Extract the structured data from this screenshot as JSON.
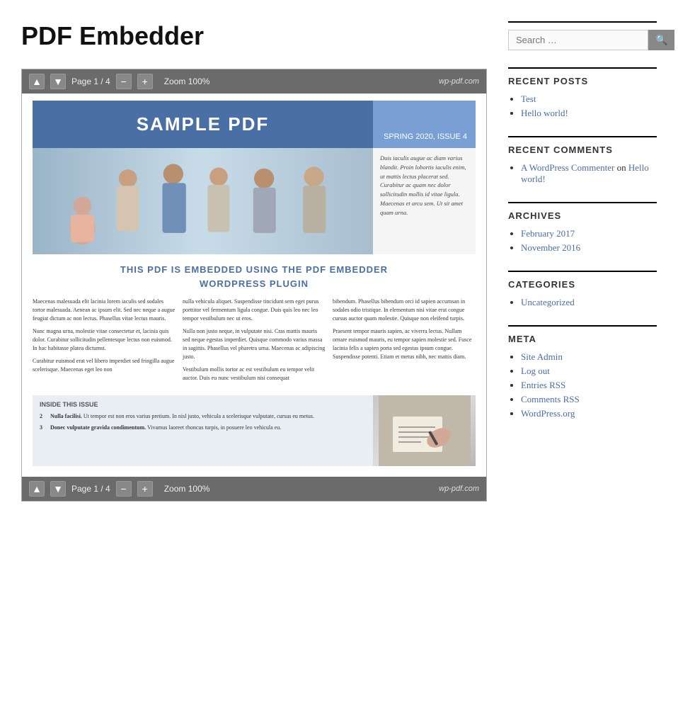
{
  "site": {
    "title": "PDF Embedder"
  },
  "search": {
    "placeholder": "Search …",
    "button_icon": "🔍"
  },
  "pdf": {
    "toolbar": {
      "page_info": "Page 1 / 4",
      "zoom": "Zoom 100%",
      "logo": "wp-pdf.com",
      "btn_prev": "▲",
      "btn_next": "▼",
      "btn_minus": "−",
      "btn_plus": "+"
    },
    "header": {
      "title": "SAMPLE PDF",
      "issue": "SPRING 2020, ISSUE 4"
    },
    "image_caption": "Duis iaculis augue ac diam varius blandit. Proin lobortis iaculis enim, ut mattis lectus placerat sed. Curabitur ac quam nec dolor sollicitudin mollis id vitae ligula. Maecenas et arcu sem. Ut sit amet quam urna.",
    "title_text_line1": "THIS PDF IS EMBEDDED USING THE PDF EMBEDDER",
    "title_text_line2": "WORDPRESS PLUGIN",
    "columns": [
      {
        "paragraphs": [
          "Maecenas malesuada elit lacinia lorem iaculis sed sodales tortor malesuada. Aenean ac ipsum elit. Sed nec neque a augue feugiat dictum ac non lectus. Phasellus vitae lectus mauris.",
          "Nunc magna urna, molestie vitae consectetur et, lacinia quis dolor. Curabitur sollicitudin pellentesque lectus non euismod. In hac habitasse platea dictumst.",
          "Curabitur euismod erat vel libero imperdiet sed fringilla augue scelerisque. Maecenas eget leo non"
        ]
      },
      {
        "paragraphs": [
          "nulla vehicula aliquet. Suspendisse tincidunt sem eget purus porttitor vel fermentum ligula congue. Duis quis leo nec leo tempor vestibulum nec ut eros.",
          "Nulla non justo neque, in vulputate nisi. Cras mattis mauris sed neque egestas imperdiet. Quisque commodo varius massa in sagittis. Phasellus vel pharetra urna. Maecenas ac adipiscing justo.",
          "Vestibulum mollis tortor ac est vestibulum eu tempor velit auctor. Duis eu nunc vestibulum nisi consequat"
        ]
      },
      {
        "paragraphs": [
          "bibendum. Phasellus bibendum orci id sapien accumsan in sodales odio tristique. In elementum nisi vitae erat congue cursus auctor quam molestie. Quisque non eleifend turpis.",
          "Praesent tempor mauris sapien, ac viverra lectus. Nullam ornare euismod mauris, eu tempor sapien molestie sed. Fusce lacinia felis a sapien porta sed egestas ipsum congue. Suspendisse potenti. Etiam et metus nibh, nec mattis diam."
        ]
      }
    ],
    "inside": {
      "title": "INSIDE THIS ISSUE",
      "items": [
        {
          "num": "2",
          "bold_text": "Nulla facilisi.",
          "text": " Ut tempor est non eros varius pretium. In nisl justo, vehicula a scelerisque vulputate, cursus eu metus."
        },
        {
          "num": "3",
          "bold_text": "Donec vulputate gravida condimentum.",
          "text": " Vivamus laoreet rhoncus turpis, in posuere leo vehicula eu."
        }
      ]
    }
  },
  "sidebar": {
    "recent_posts": {
      "title": "RECENT POSTS",
      "items": [
        {
          "label": "Test",
          "href": "#"
        },
        {
          "label": "Hello world!",
          "href": "#"
        }
      ]
    },
    "recent_comments": {
      "title": "RECENT COMMENTS",
      "commenter": "A WordPress Commenter",
      "on_text": "on",
      "post": "Hello world!",
      "commenter_href": "#",
      "post_href": "#"
    },
    "archives": {
      "title": "ARCHIVES",
      "items": [
        {
          "label": "February 2017",
          "href": "#"
        },
        {
          "label": "November 2016",
          "href": "#"
        }
      ]
    },
    "categories": {
      "title": "CATEGORIES",
      "items": [
        {
          "label": "Uncategorized",
          "href": "#"
        }
      ]
    },
    "meta": {
      "title": "META",
      "items": [
        {
          "label": "Site Admin",
          "href": "#"
        },
        {
          "label": "Log out",
          "href": "#"
        },
        {
          "label": "Entries RSS",
          "href": "#"
        },
        {
          "label": "Comments RSS",
          "href": "#"
        },
        {
          "label": "WordPress.org",
          "href": "#"
        }
      ]
    }
  }
}
